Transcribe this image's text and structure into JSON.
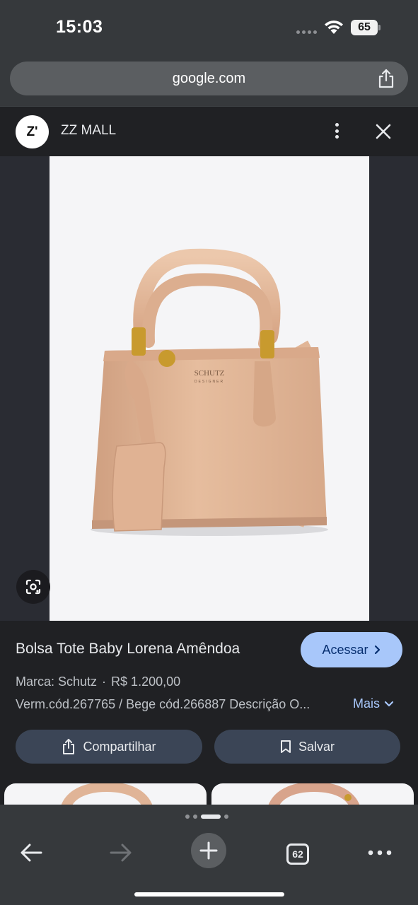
{
  "status": {
    "time": "15:03",
    "battery": "65"
  },
  "browser": {
    "url": "google.com"
  },
  "header": {
    "logo_text": "Z'",
    "site_name": "ZZ MALL"
  },
  "product": {
    "title": "Bolsa Tote Baby Lorena Amêndoa",
    "brand": "Marca: Schutz",
    "separator": "·",
    "price": "R$ 1.200,00",
    "description": "Verm.cód.267765 / Bege cód.266887 Descrição O...",
    "more_label": "Mais",
    "bag_logo": "SCHUTZ",
    "bag_logo_sub": "DESIGNER"
  },
  "actions": {
    "visit_label": "Acessar",
    "share_label": "Compartilhar",
    "save_label": "Salvar"
  },
  "toolbar": {
    "tab_count": "62"
  },
  "colors": {
    "accent": "#a8c7fa",
    "chrome": "#36393c",
    "background": "#202124",
    "bag": "#e2b999"
  },
  "icons": [
    "wifi-icon",
    "share-icon",
    "more-vert-icon",
    "close-icon",
    "lens-icon",
    "chevron-right-icon",
    "chevron-down-icon",
    "bookmark-icon",
    "back-icon",
    "forward-icon",
    "plus-icon",
    "tabs-icon",
    "more-horiz-icon"
  ]
}
